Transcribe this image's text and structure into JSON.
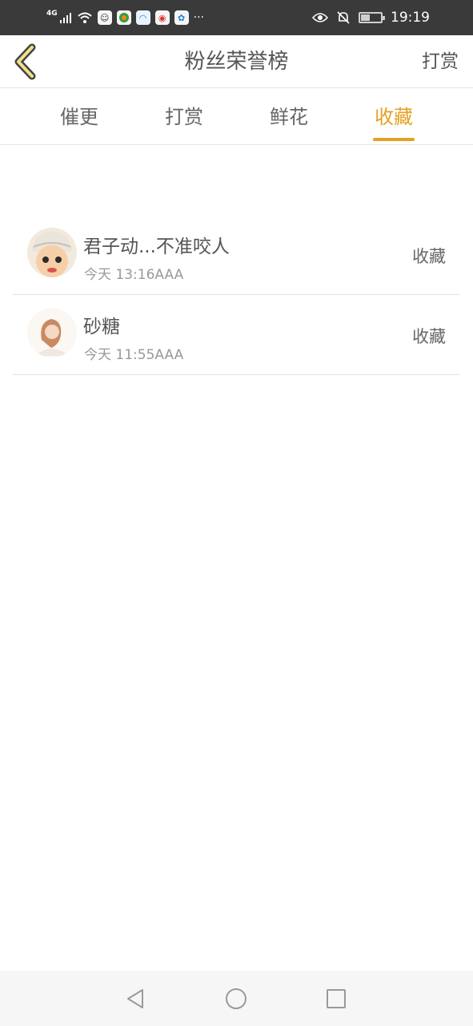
{
  "status_bar": {
    "network": "4G",
    "icons": [
      "signal-icon",
      "wifi-icon",
      "qq-app-icon",
      "browser-app-icon",
      "app-icon",
      "weibo-app-icon",
      "baidu-app-icon"
    ],
    "overflow": "···",
    "right_icons": [
      "eye-icon",
      "bell-off-icon",
      "battery-icon"
    ],
    "battery_level": 0.45,
    "time": "19:19"
  },
  "header": {
    "title": "粉丝荣誉榜",
    "action": "打赏"
  },
  "tabs": [
    {
      "label": "催更",
      "active": false
    },
    {
      "label": "打赏",
      "active": false
    },
    {
      "label": "鲜花",
      "active": false
    },
    {
      "label": "收藏",
      "active": true
    }
  ],
  "list": [
    {
      "name": "君子动...不准咬人",
      "time": "今天 13:16AAA",
      "action": "收藏"
    },
    {
      "name": "砂糖",
      "time": "今天 11:55AAA",
      "action": "收藏"
    }
  ],
  "colors": {
    "accent": "#e6a023",
    "statusbar": "#3a3a3a",
    "text": "#555555"
  }
}
